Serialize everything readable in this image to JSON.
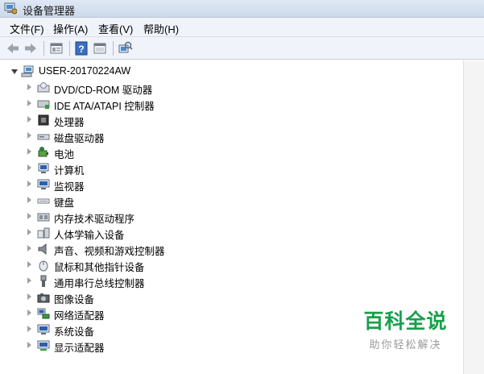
{
  "window": {
    "title": "设备管理器"
  },
  "menu": [
    {
      "label": "文件(F)"
    },
    {
      "label": "操作(A)"
    },
    {
      "label": "查看(V)"
    },
    {
      "label": "帮助(H)"
    }
  ],
  "toolbar": {
    "buttons": [
      {
        "icon": "back-arrow-icon"
      },
      {
        "icon": "forward-arrow-icon"
      },
      {
        "icon": "properties-icon"
      },
      {
        "icon": "help-icon"
      },
      {
        "icon": "show-hidden-icon"
      },
      {
        "icon": "scan-hardware-icon"
      }
    ]
  },
  "tree": {
    "root": {
      "label": "USER-20170224AW"
    },
    "items": [
      {
        "label": "DVD/CD-ROM 驱动器",
        "icon": "dvd-drive-icon"
      },
      {
        "label": "IDE ATA/ATAPI 控制器",
        "icon": "ide-controller-icon"
      },
      {
        "label": "处理器",
        "icon": "processor-icon"
      },
      {
        "label": "磁盘驱动器",
        "icon": "disk-drive-icon"
      },
      {
        "label": "电池",
        "icon": "battery-icon"
      },
      {
        "label": "计算机",
        "icon": "computer-icon"
      },
      {
        "label": "监视器",
        "icon": "monitor-icon"
      },
      {
        "label": "键盘",
        "icon": "keyboard-icon"
      },
      {
        "label": "内存技术驱动程序",
        "icon": "memory-tech-icon"
      },
      {
        "label": "人体学输入设备",
        "icon": "hid-icon"
      },
      {
        "label": "声音、视频和游戏控制器",
        "icon": "speaker-icon"
      },
      {
        "label": "鼠标和其他指针设备",
        "icon": "mouse-icon"
      },
      {
        "label": "通用串行总线控制器",
        "icon": "usb-icon"
      },
      {
        "label": "图像设备",
        "icon": "camera-icon"
      },
      {
        "label": "网络适配器",
        "icon": "network-adapter-icon"
      },
      {
        "label": "系统设备",
        "icon": "system-device-icon"
      },
      {
        "label": "显示适配器",
        "icon": "display-adapter-icon"
      }
    ]
  },
  "watermark": {
    "title": "百科全说",
    "subtitle": "助你轻松解决"
  }
}
